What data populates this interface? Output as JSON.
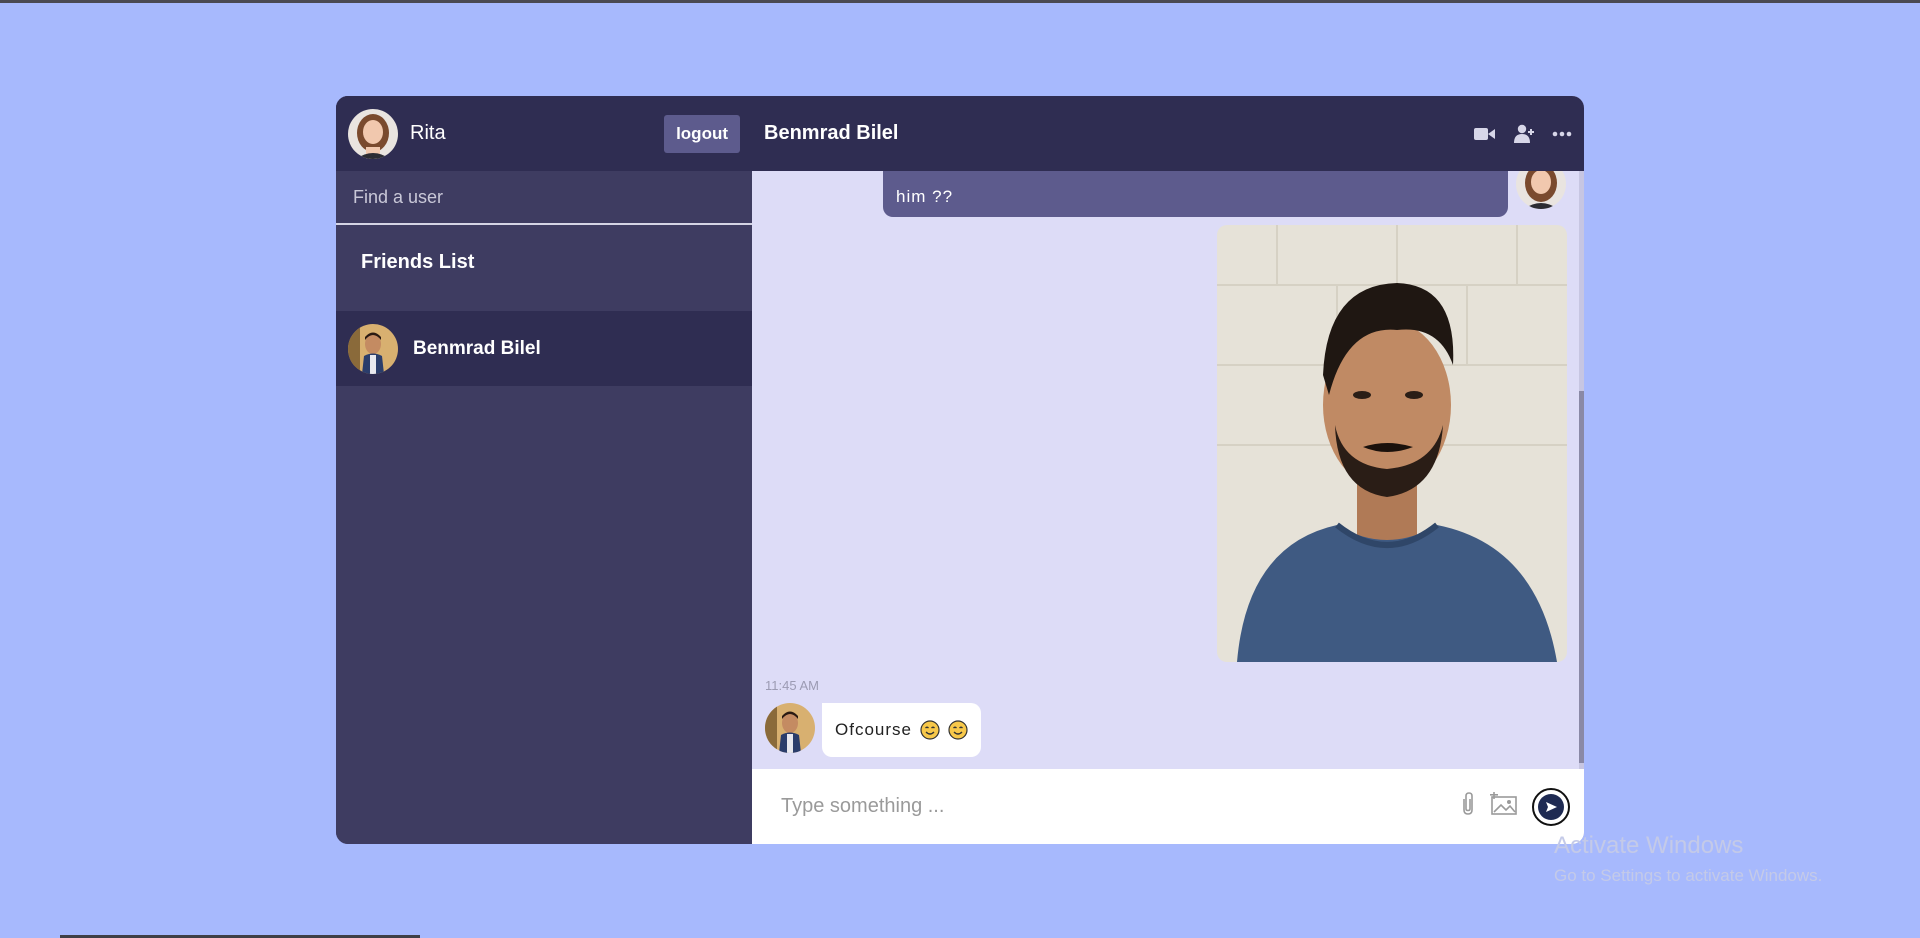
{
  "sidebar": {
    "current_user": "Rita",
    "logout_label": "logout",
    "search_placeholder": "Find a user",
    "friends_title": "Friends List",
    "friends": [
      {
        "name": "Benmrad Bilel"
      }
    ]
  },
  "chat": {
    "title": "Benmrad Bilel",
    "header_icons": [
      "video-camera-icon",
      "add-user-icon",
      "more-options-icon"
    ],
    "messages": {
      "owner_text": "him ??",
      "friend_time": "11:45 AM",
      "friend_text": "Ofcourse"
    },
    "input_placeholder": "Type something ...",
    "input_icons": [
      "attach-icon",
      "add-image-icon",
      "send-icon"
    ]
  },
  "watermark": {
    "title": "Activate Windows",
    "subtitle": "Go to Settings to activate Windows."
  },
  "colors": {
    "background": "#a7b9fd",
    "sidebar": "#3e3c61",
    "header": "#2f2d52",
    "owner_bubble": "#5d5b8d",
    "chat_background": "#dddcf7"
  }
}
